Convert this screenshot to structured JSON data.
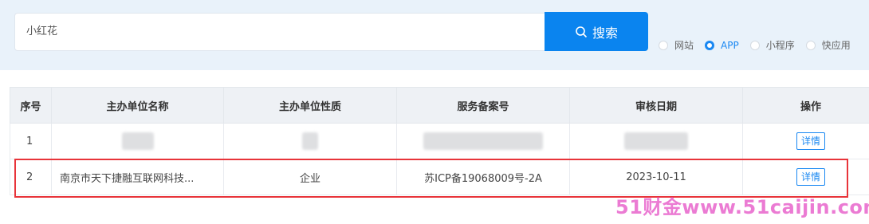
{
  "search": {
    "value": "小红花",
    "button_label": "搜索"
  },
  "filters": [
    {
      "label": "网站",
      "selected": false
    },
    {
      "label": "APP",
      "selected": true
    },
    {
      "label": "小程序",
      "selected": false
    },
    {
      "label": "快应用",
      "selected": false
    }
  ],
  "table": {
    "headers": [
      "序号",
      "主办单位名称",
      "主办单位性质",
      "服务备案号",
      "审核日期",
      "操作"
    ],
    "rows": [
      {
        "index": "1",
        "name": "",
        "nature": "",
        "record": "",
        "date": "",
        "action": "详情"
      },
      {
        "index": "2",
        "name": "南京市天下捷融互联网科技...",
        "nature": "企业",
        "record": "苏ICP备19068009号-2A",
        "date": "2023-10-11",
        "action": "详情"
      }
    ]
  },
  "watermark": "51财金www.51caijin.com",
  "colors": {
    "accent": "#0a84ef",
    "highlight": "#e8343a"
  }
}
